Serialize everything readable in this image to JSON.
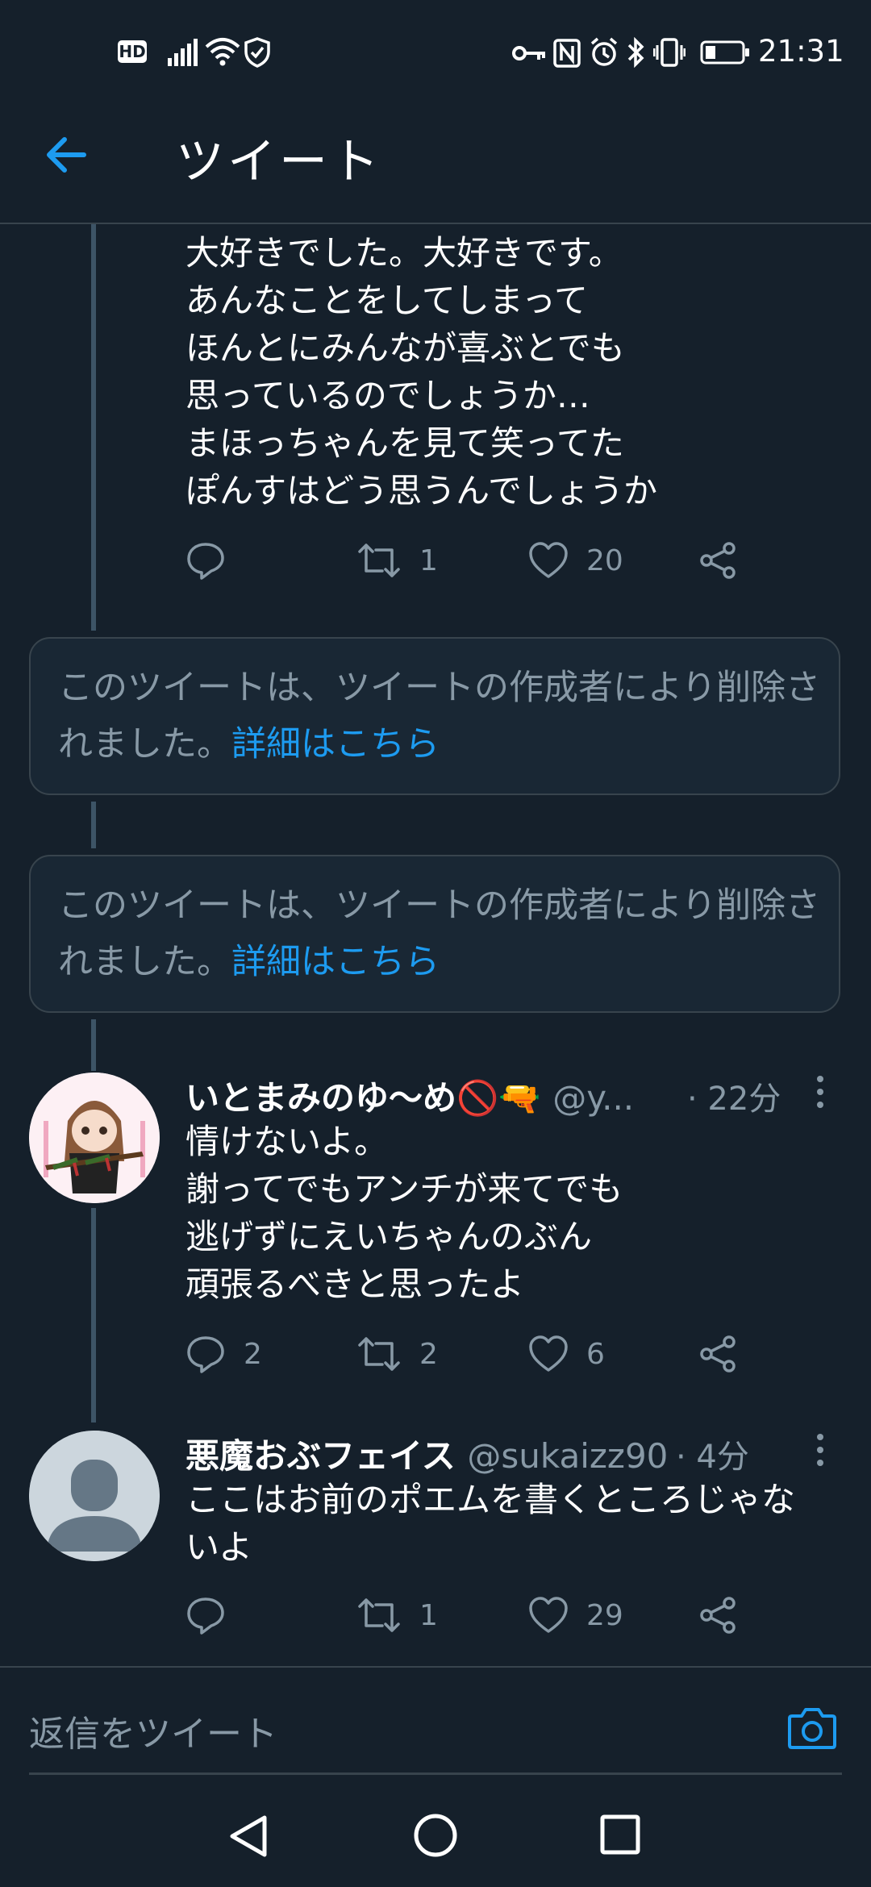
{
  "status_bar": {
    "hd": "HD",
    "time": "21:31"
  },
  "header": {
    "title": "ツイート"
  },
  "tweets": [
    {
      "text": "大好きでした。大好きです。\nあんなことをしてしまって\nほんとにみんなが喜ぶとでも\n思っているのでしょうか…\nまほっちゃんを見て笑ってた\nぽんすはどう思うんでしょうか",
      "reply_count": "",
      "retweet_count": "1",
      "like_count": "20"
    },
    {
      "author": "いとまみのゆ〜め",
      "author_emoji": "🚫🔫",
      "handle": "@y...",
      "time": "· 22分",
      "text": "情けないよ。\n謝ってでもアンチが来てでも\n逃げずにえいちゃんのぶん\n頑張るべきと思ったよ",
      "reply_count": "2",
      "retweet_count": "2",
      "like_count": "6"
    },
    {
      "author": "悪魔おぶフェイス",
      "handle": "@sukaizz90",
      "time": "· 4分",
      "text": "ここはお前のポエムを書くところじゃな\nいよ",
      "reply_count": "",
      "retweet_count": "1",
      "like_count": "29"
    }
  ],
  "deleted_notices": [
    {
      "text": "このツイートは、ツイートの作成者により削除されました。",
      "link": "詳細はこちら"
    },
    {
      "text": "このツイートは、ツイートの作成者により削除されました。",
      "link": "詳細はこちら"
    }
  ],
  "reply_bar": {
    "placeholder": "返信をツイート"
  },
  "colors": {
    "background": "#15202b",
    "accent": "#1d9bf0",
    "secondary_text": "#8899a6",
    "divider": "#38444d"
  },
  "icons": [
    "back-arrow-icon",
    "reply-icon",
    "retweet-icon",
    "like-icon",
    "share-icon",
    "more-options-icon",
    "camera-icon",
    "nav-back-icon",
    "nav-home-icon",
    "nav-recents-icon"
  ]
}
